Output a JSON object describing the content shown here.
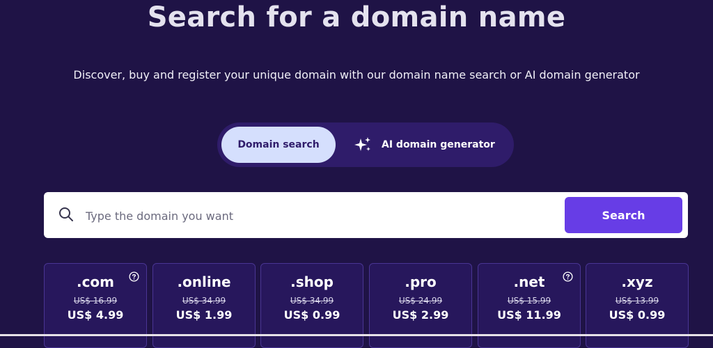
{
  "header": {
    "title": "Search for a domain name",
    "subtitle": "Discover, buy and register your unique domain with our domain name search or AI domain generator"
  },
  "toggle": {
    "domain_search_label": "Domain search",
    "ai_generator_label": "AI domain generator",
    "active": "Domain search"
  },
  "search": {
    "placeholder": "Type the domain you want",
    "value": "",
    "button_label": "Search"
  },
  "tlds": [
    {
      "name": ".com",
      "old_price": "US$ 16.99",
      "price": "US$ 4.99",
      "help": true
    },
    {
      "name": ".online",
      "old_price": "US$ 34.99",
      "price": "US$ 1.99",
      "help": false
    },
    {
      "name": ".shop",
      "old_price": "US$ 34.99",
      "price": "US$ 0.99",
      "help": false
    },
    {
      "name": ".pro",
      "old_price": "US$ 24.99",
      "price": "US$ 2.99",
      "help": false
    },
    {
      "name": ".net",
      "old_price": "US$ 15.99",
      "price": "US$ 11.99",
      "help": true
    },
    {
      "name": ".xyz",
      "old_price": "US$ 13.99",
      "price": "US$ 0.99",
      "help": false
    }
  ],
  "colors": {
    "background": "#1f1346",
    "accent": "#673de6",
    "toggle_active": "#d5dffd"
  },
  "icons": {
    "search": "search-icon",
    "ai": "sparkle-icon",
    "help": "help-circle-icon"
  }
}
